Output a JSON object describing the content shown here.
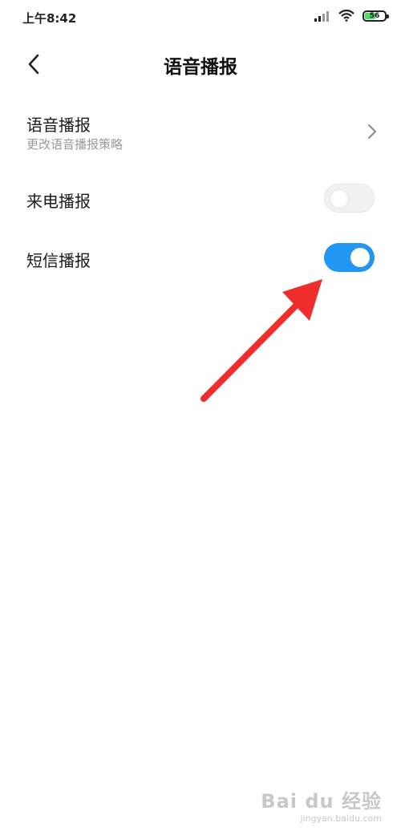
{
  "status_bar": {
    "time": "上午8:42",
    "battery_level": "56",
    "battery_fraction": 0.56,
    "battery_color": "#4cd964",
    "icons": [
      "signal-icon",
      "wifi-icon",
      "battery-icon"
    ]
  },
  "header": {
    "title": "语音播报",
    "back_icon": "chevron-left-icon"
  },
  "settings": {
    "voice_broadcast": {
      "title": "语音播报",
      "subtitle": "更改语音播报策略",
      "icon": "chevron-right-icon"
    },
    "call_broadcast": {
      "title": "来电播报",
      "toggle_on": false
    },
    "sms_broadcast": {
      "title": "短信播报",
      "toggle_on": true
    }
  },
  "colors": {
    "toggle_on": "#2196f3",
    "toggle_off": "#f1f1f1",
    "annotation_arrow": "#f02d2d",
    "subtitle": "#9a9a9a"
  },
  "watermark": {
    "main": "Bai du 经验",
    "sub": "jingyan.baidu.com"
  }
}
